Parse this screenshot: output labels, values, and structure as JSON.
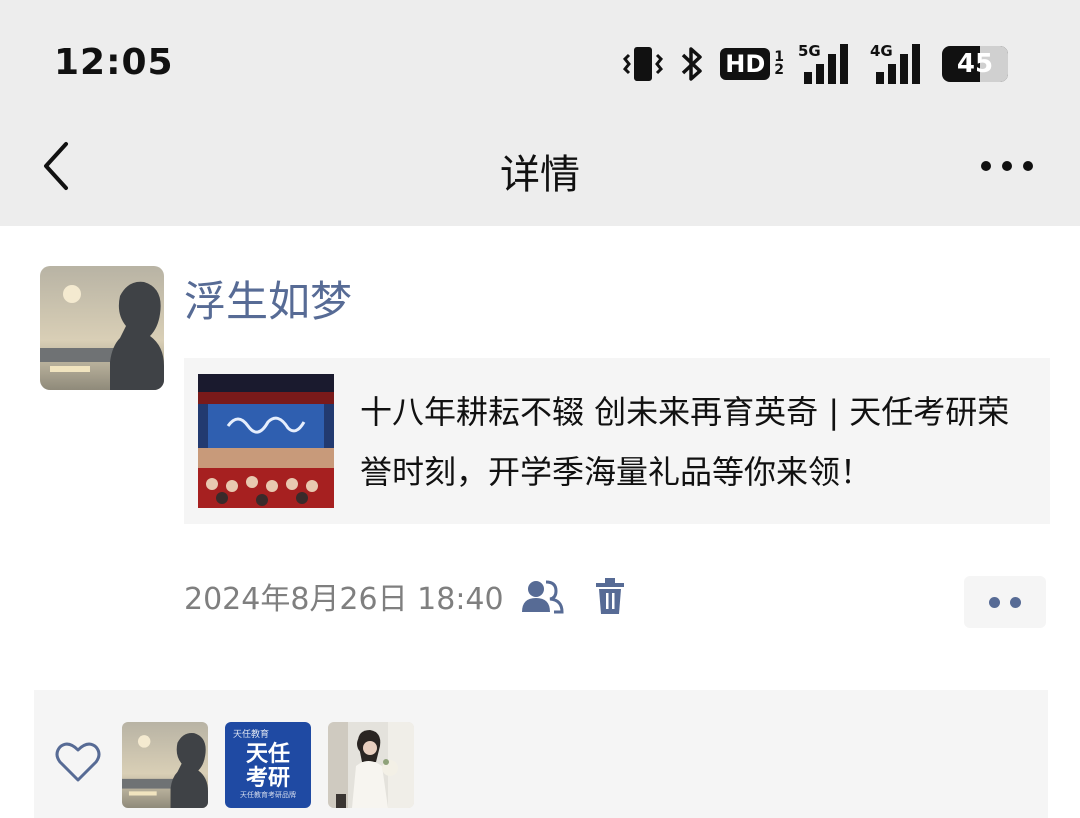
{
  "status_bar": {
    "time": "12:05",
    "hd_label": "HD",
    "hd_sub_1": "1",
    "hd_sub_2": "2",
    "net1": "5G",
    "net2": "4G",
    "battery": "45",
    "icons": [
      "vibrate-icon",
      "bluetooth-icon",
      "signal-icon",
      "battery-icon"
    ]
  },
  "nav": {
    "title": "详情",
    "icons": [
      "back-icon",
      "more-icon"
    ]
  },
  "post": {
    "author": "浮生如梦",
    "link_title": "十八年耕耘不辍 创未来再育英奇 | 天任考研荣誉时刻，开学季海量礼品等你来领！",
    "timestamp": "2024年8月26日 18:40",
    "icons": [
      "visibility-group-icon",
      "trash-icon",
      "more-dots-icon"
    ]
  },
  "likes": {
    "icon": "heart-icon",
    "brand_avatar": {
      "top": "天任教育",
      "main_line1": "天任",
      "main_line2": "考研",
      "bottom": "天任教育考研品牌"
    }
  },
  "colors": {
    "link_blue": "#576b95",
    "background_gray": "#ededed",
    "card_gray": "#f5f5f5",
    "brand_blue": "#1f4aa3"
  }
}
